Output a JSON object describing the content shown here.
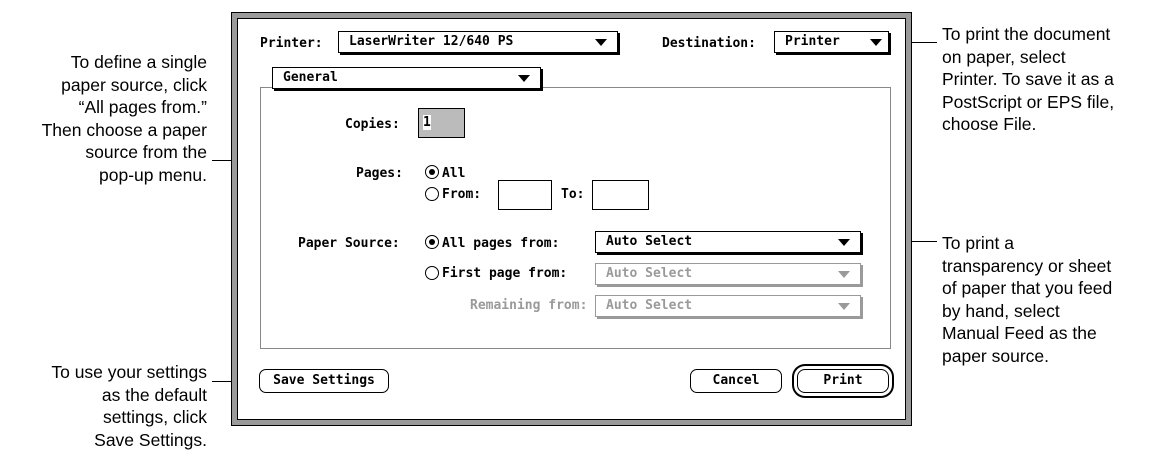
{
  "annotations": {
    "left_top": [
      "To define a single",
      "paper source, click",
      "“All pages from.”",
      "Then choose a paper",
      "source from the",
      "pop-up menu."
    ],
    "left_bottom": [
      "To use your settings",
      "as the default",
      "settings, click",
      "Save Settings."
    ],
    "right_top": [
      "To print the document",
      "on paper, select",
      "Printer. To save it as a",
      "PostScript or EPS file,",
      "choose File."
    ],
    "right_bottom": [
      "To print a",
      "transparency or sheet",
      "of paper that you feed",
      "by hand, select",
      "Manual Feed as the",
      "paper source."
    ]
  },
  "dialog": {
    "printer_label": "Printer:",
    "printer_value": "LaserWriter 12/640 PS",
    "destination_label": "Destination:",
    "destination_value": "Printer",
    "panel_value": "General",
    "copies_label": "Copies:",
    "copies_value": "1",
    "pages_label": "Pages:",
    "pages_all": "All",
    "pages_from": "From:",
    "pages_to": "To:",
    "paper_source_label": "Paper Source:",
    "all_pages_from": "All pages from:",
    "all_pages_value": "Auto Select",
    "first_page_from": "First page from:",
    "first_page_value": "Auto Select",
    "remaining_from": "Remaining from:",
    "remaining_value": "Auto Select",
    "save_settings": "Save Settings",
    "cancel": "Cancel",
    "print": "Print"
  }
}
